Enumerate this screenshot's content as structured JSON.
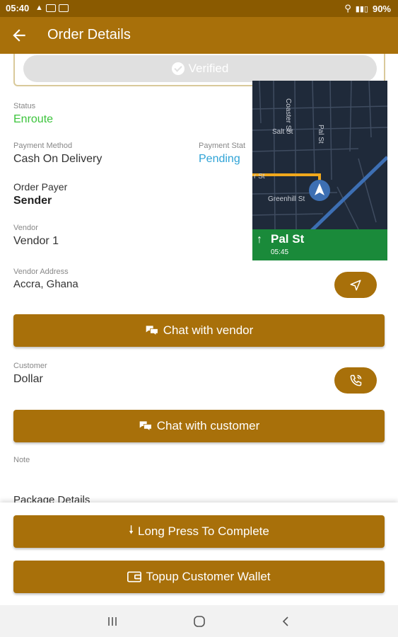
{
  "status_bar": {
    "time": "05:40",
    "battery": "90%"
  },
  "app_bar": {
    "title": "Order Details"
  },
  "verified": {
    "label": "Verified"
  },
  "order": {
    "status_label": "Status",
    "status_value": "Enroute",
    "payment_method_label": "Payment Method",
    "payment_method_value": "Cash On Delivery",
    "payment_status_label": "Payment Stat",
    "payment_status_value": "Pending",
    "order_payer_label": "Order Payer",
    "order_payer_value": "Sender",
    "vendor_label": "Vendor",
    "vendor_value": "Vendor 1",
    "vendor_address_label": "Vendor Address",
    "vendor_address_value": "Accra, Ghana",
    "customer_label": "Customer",
    "customer_value": "Dollar",
    "note_label": "Note",
    "package_details_label": "Package Details"
  },
  "map": {
    "streets": [
      "Coaster St",
      "Salt St",
      "Pal St",
      "Greenhill St",
      "r St"
    ],
    "banner_street": "Pal St",
    "banner_time": "05:45"
  },
  "buttons": {
    "chat_vendor": "Chat with vendor",
    "chat_customer": "Chat with customer",
    "long_press": "Long Press To Complete",
    "topup": "Topup Customer Wallet"
  },
  "colors": {
    "primary": "#a8700a",
    "status_bar": "#8a5a00",
    "enroute": "#3cc43c",
    "pending": "#2fa3d6",
    "nav_green": "#1a8a3a"
  }
}
